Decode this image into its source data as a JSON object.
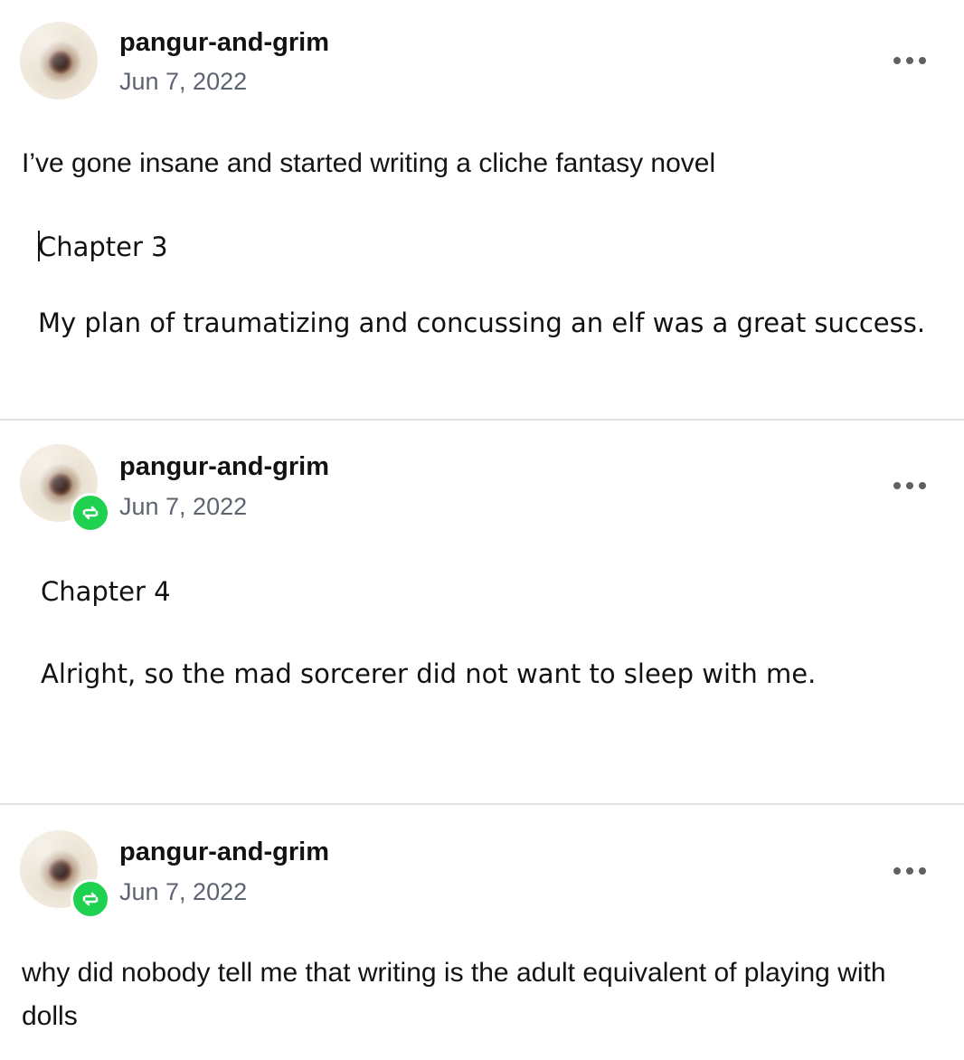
{
  "posts": [
    {
      "username": "pangur-and-grim",
      "date": "Jun 7, 2022",
      "reblog": false,
      "text": "I’ve gone insane and started writing a cliche fantasy novel",
      "image_lines": [
        "Chapter 3",
        "My plan of traumatizing and concussing an elf was a great success."
      ]
    },
    {
      "username": "pangur-and-grim",
      "date": "Jun 7, 2022",
      "reblog": true,
      "image_lines": [
        "Chapter 4",
        "Alright, so the mad sorcerer did not want to sleep with me."
      ]
    },
    {
      "username": "pangur-and-grim",
      "date": "Jun 7, 2022",
      "reblog": true,
      "text": "why did nobody tell me that writing is the adult equivalent of playing with dolls"
    }
  ],
  "colors": {
    "reblog_badge": "#1ed14f",
    "date": "#5d6471",
    "separator": "#e3e3e3"
  }
}
